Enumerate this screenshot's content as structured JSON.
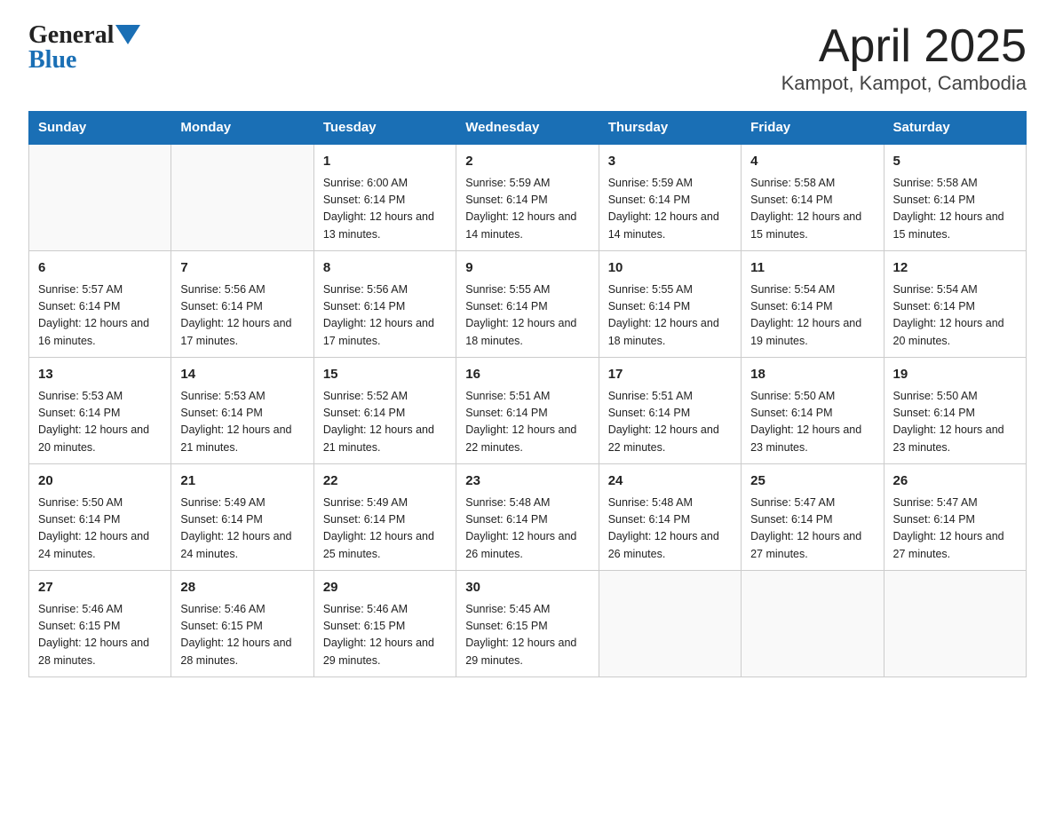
{
  "header": {
    "logo_general": "General",
    "logo_blue": "Blue",
    "title": "April 2025",
    "location": "Kampot, Kampot, Cambodia"
  },
  "days_of_week": [
    "Sunday",
    "Monday",
    "Tuesday",
    "Wednesday",
    "Thursday",
    "Friday",
    "Saturday"
  ],
  "weeks": [
    [
      {
        "day": "",
        "info": ""
      },
      {
        "day": "",
        "info": ""
      },
      {
        "day": "1",
        "info": "Sunrise: 6:00 AM\nSunset: 6:14 PM\nDaylight: 12 hours\nand 13 minutes."
      },
      {
        "day": "2",
        "info": "Sunrise: 5:59 AM\nSunset: 6:14 PM\nDaylight: 12 hours\nand 14 minutes."
      },
      {
        "day": "3",
        "info": "Sunrise: 5:59 AM\nSunset: 6:14 PM\nDaylight: 12 hours\nand 14 minutes."
      },
      {
        "day": "4",
        "info": "Sunrise: 5:58 AM\nSunset: 6:14 PM\nDaylight: 12 hours\nand 15 minutes."
      },
      {
        "day": "5",
        "info": "Sunrise: 5:58 AM\nSunset: 6:14 PM\nDaylight: 12 hours\nand 15 minutes."
      }
    ],
    [
      {
        "day": "6",
        "info": "Sunrise: 5:57 AM\nSunset: 6:14 PM\nDaylight: 12 hours\nand 16 minutes."
      },
      {
        "day": "7",
        "info": "Sunrise: 5:56 AM\nSunset: 6:14 PM\nDaylight: 12 hours\nand 17 minutes."
      },
      {
        "day": "8",
        "info": "Sunrise: 5:56 AM\nSunset: 6:14 PM\nDaylight: 12 hours\nand 17 minutes."
      },
      {
        "day": "9",
        "info": "Sunrise: 5:55 AM\nSunset: 6:14 PM\nDaylight: 12 hours\nand 18 minutes."
      },
      {
        "day": "10",
        "info": "Sunrise: 5:55 AM\nSunset: 6:14 PM\nDaylight: 12 hours\nand 18 minutes."
      },
      {
        "day": "11",
        "info": "Sunrise: 5:54 AM\nSunset: 6:14 PM\nDaylight: 12 hours\nand 19 minutes."
      },
      {
        "day": "12",
        "info": "Sunrise: 5:54 AM\nSunset: 6:14 PM\nDaylight: 12 hours\nand 20 minutes."
      }
    ],
    [
      {
        "day": "13",
        "info": "Sunrise: 5:53 AM\nSunset: 6:14 PM\nDaylight: 12 hours\nand 20 minutes."
      },
      {
        "day": "14",
        "info": "Sunrise: 5:53 AM\nSunset: 6:14 PM\nDaylight: 12 hours\nand 21 minutes."
      },
      {
        "day": "15",
        "info": "Sunrise: 5:52 AM\nSunset: 6:14 PM\nDaylight: 12 hours\nand 21 minutes."
      },
      {
        "day": "16",
        "info": "Sunrise: 5:51 AM\nSunset: 6:14 PM\nDaylight: 12 hours\nand 22 minutes."
      },
      {
        "day": "17",
        "info": "Sunrise: 5:51 AM\nSunset: 6:14 PM\nDaylight: 12 hours\nand 22 minutes."
      },
      {
        "day": "18",
        "info": "Sunrise: 5:50 AM\nSunset: 6:14 PM\nDaylight: 12 hours\nand 23 minutes."
      },
      {
        "day": "19",
        "info": "Sunrise: 5:50 AM\nSunset: 6:14 PM\nDaylight: 12 hours\nand 23 minutes."
      }
    ],
    [
      {
        "day": "20",
        "info": "Sunrise: 5:50 AM\nSunset: 6:14 PM\nDaylight: 12 hours\nand 24 minutes."
      },
      {
        "day": "21",
        "info": "Sunrise: 5:49 AM\nSunset: 6:14 PM\nDaylight: 12 hours\nand 24 minutes."
      },
      {
        "day": "22",
        "info": "Sunrise: 5:49 AM\nSunset: 6:14 PM\nDaylight: 12 hours\nand 25 minutes."
      },
      {
        "day": "23",
        "info": "Sunrise: 5:48 AM\nSunset: 6:14 PM\nDaylight: 12 hours\nand 26 minutes."
      },
      {
        "day": "24",
        "info": "Sunrise: 5:48 AM\nSunset: 6:14 PM\nDaylight: 12 hours\nand 26 minutes."
      },
      {
        "day": "25",
        "info": "Sunrise: 5:47 AM\nSunset: 6:14 PM\nDaylight: 12 hours\nand 27 minutes."
      },
      {
        "day": "26",
        "info": "Sunrise: 5:47 AM\nSunset: 6:14 PM\nDaylight: 12 hours\nand 27 minutes."
      }
    ],
    [
      {
        "day": "27",
        "info": "Sunrise: 5:46 AM\nSunset: 6:15 PM\nDaylight: 12 hours\nand 28 minutes."
      },
      {
        "day": "28",
        "info": "Sunrise: 5:46 AM\nSunset: 6:15 PM\nDaylight: 12 hours\nand 28 minutes."
      },
      {
        "day": "29",
        "info": "Sunrise: 5:46 AM\nSunset: 6:15 PM\nDaylight: 12 hours\nand 29 minutes."
      },
      {
        "day": "30",
        "info": "Sunrise: 5:45 AM\nSunset: 6:15 PM\nDaylight: 12 hours\nand 29 minutes."
      },
      {
        "day": "",
        "info": ""
      },
      {
        "day": "",
        "info": ""
      },
      {
        "day": "",
        "info": ""
      }
    ]
  ]
}
